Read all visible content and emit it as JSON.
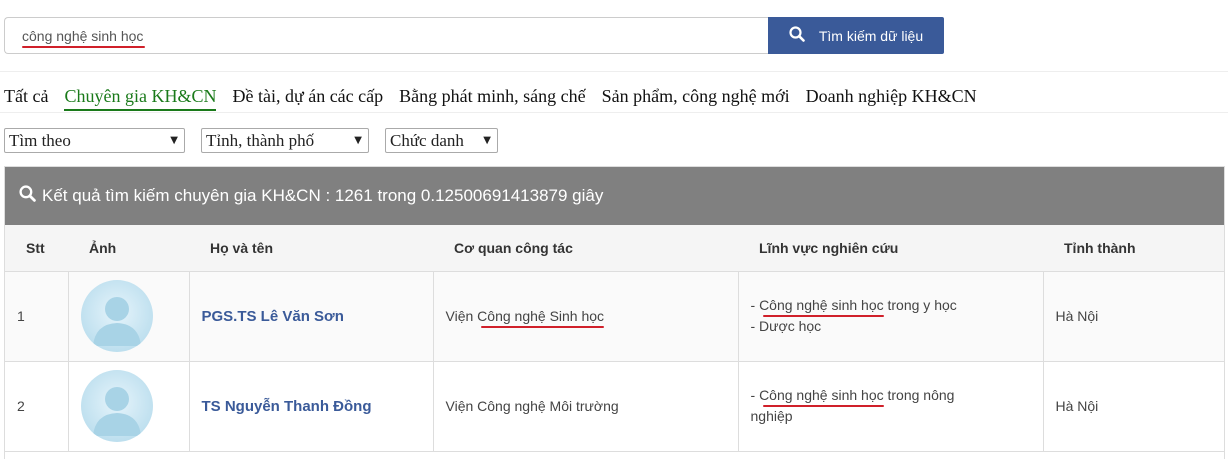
{
  "search": {
    "query": "công nghệ sinh học",
    "button_label": "Tìm kiếm dữ liệu"
  },
  "tabs": [
    {
      "label": "Tất cả",
      "active": false
    },
    {
      "label": "Chuyên gia KH&CN",
      "active": true
    },
    {
      "label": "Đề tài, dự án các cấp",
      "active": false
    },
    {
      "label": "Bằng phát minh, sáng chế",
      "active": false
    },
    {
      "label": "Sản phẩm, công nghệ mới",
      "active": false
    },
    {
      "label": "Doanh nghiệp KH&CN",
      "active": false
    }
  ],
  "filters": {
    "search_by": "Tìm theo",
    "province": "Tỉnh, thành phố",
    "title": "Chức danh"
  },
  "results": {
    "summary": "Kết quả tìm kiếm chuyên gia KH&CN : 1261 trong 0.12500691413879 giây",
    "columns": [
      "Stt",
      "Ảnh",
      "Họ và tên",
      "Cơ quan công tác",
      "Lĩnh vực nghiên cứu",
      "Tỉnh thành"
    ],
    "rows": [
      {
        "stt": "1",
        "name": "PGS.TS Lê Văn Sơn",
        "org_prefix": "Viện ",
        "org_highlight": "Công nghệ Sinh học",
        "field_line1_prefix": "- ",
        "field_line1_highlight": "Công nghệ sinh học",
        "field_line1_suffix": " trong y học",
        "field_line2": "- Dược học",
        "province": "Hà Nội"
      },
      {
        "stt": "2",
        "name": "TS Nguyễn Thanh Đồng",
        "org_prefix": "Viện Công nghệ Môi trường",
        "org_highlight": "",
        "field_line1_prefix": "- ",
        "field_line1_highlight": "Công nghệ sinh học",
        "field_line1_suffix": " trong nông",
        "field_line2": "nghiệp",
        "province": "Hà Nội"
      }
    ]
  },
  "colors": {
    "accent": "#3a5a99",
    "active_tab": "#1a7a1a",
    "header_bar": "#808080",
    "highlight_underline": "#d0202a"
  },
  "icons": {
    "search": "search-icon",
    "dropdown": "caret-down-icon",
    "avatar": "user-placeholder-icon"
  }
}
